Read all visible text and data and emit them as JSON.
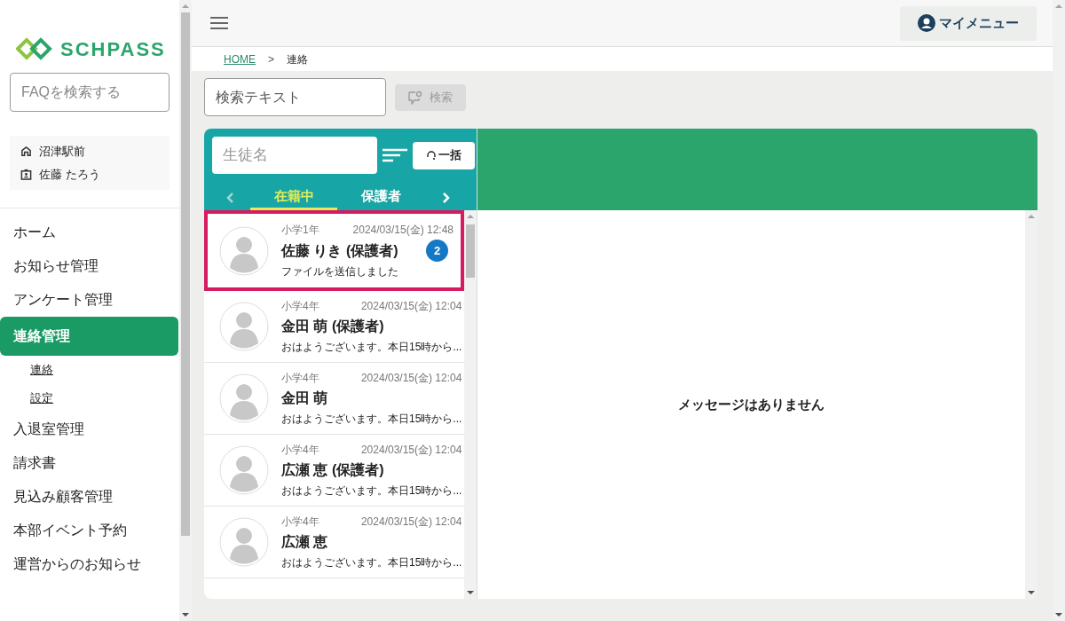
{
  "logo": {
    "text": "SCHPASS"
  },
  "faq_search": {
    "placeholder": "FAQを検索する"
  },
  "account": {
    "school": "沼津駅前",
    "user": "佐藤 たろう"
  },
  "sidebar": {
    "items": [
      {
        "label": "ホーム",
        "selected": false
      },
      {
        "label": "お知らせ管理",
        "selected": false
      },
      {
        "label": "アンケート管理",
        "selected": false
      },
      {
        "label": "連絡管理",
        "selected": true,
        "children": [
          {
            "label": "連絡"
          },
          {
            "label": "設定"
          }
        ]
      },
      {
        "label": "入退室管理",
        "selected": false
      },
      {
        "label": "請求書",
        "selected": false
      },
      {
        "label": "見込み顧客管理",
        "selected": false
      },
      {
        "label": "本部イベント予約",
        "selected": false
      },
      {
        "label": "運営からのお知らせ",
        "selected": false
      }
    ]
  },
  "header": {
    "my_menu": "マイメニュー"
  },
  "breadcrumb": [
    {
      "label": "HOME",
      "link": true
    },
    {
      "label": "連絡",
      "link": false
    }
  ],
  "breadcrumb_separator": ">",
  "search": {
    "placeholder": "検索テキスト",
    "button": "検索",
    "disabled": true
  },
  "student_filter": {
    "placeholder": "生徒名",
    "bulk_button": "一括"
  },
  "tabs": [
    {
      "label": "在籍中",
      "selected": true
    },
    {
      "label": "保護者",
      "selected": false
    }
  ],
  "conversations": [
    {
      "grade": "小学1年",
      "time": "2024/03/15(金) 12:48",
      "name": "佐藤 りき (保護者)",
      "preview": "ファイルを送信しました",
      "unread": "2",
      "selected": true
    },
    {
      "grade": "小学4年",
      "time": "2024/03/15(金) 12:04",
      "name": "金田 萌 (保護者)",
      "preview": "おはようございます。本日15時から...",
      "selected": false
    },
    {
      "grade": "小学4年",
      "time": "2024/03/15(金) 12:04",
      "name": "金田 萌",
      "preview": "おはようございます。本日15時から...",
      "selected": false
    },
    {
      "grade": "小学4年",
      "time": "2024/03/15(金) 12:04",
      "name": "広瀬 恵 (保護者)",
      "preview": "おはようございます。本日15時から...",
      "selected": false
    },
    {
      "grade": "小学4年",
      "time": "2024/03/15(金) 12:04",
      "name": "広瀬 恵",
      "preview": "おはようございます。本日15時から...",
      "selected": false
    }
  ],
  "message_pane": {
    "empty_text": "メッセージはありません"
  }
}
